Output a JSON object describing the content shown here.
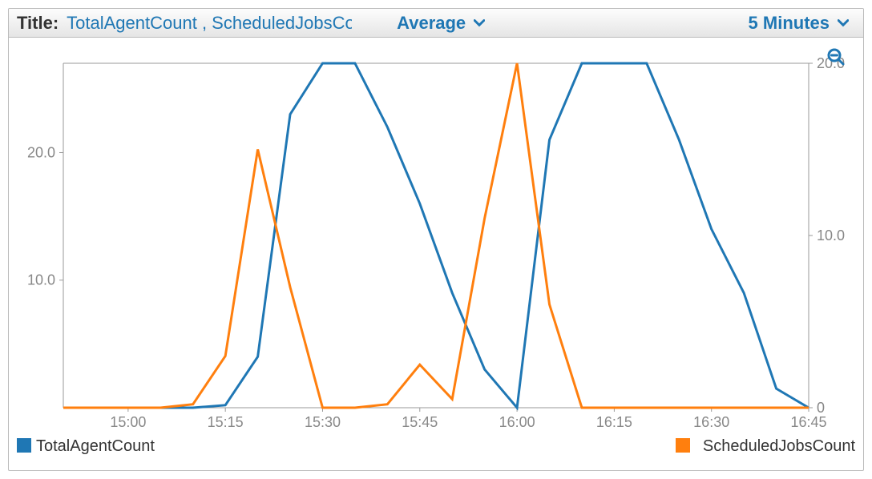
{
  "toolbar": {
    "title_label": "Title:",
    "title_value": "TotalAgentCount , ScheduledJobsCount",
    "aggregation": {
      "selected": "Average"
    },
    "period": {
      "selected": "5 Minutes"
    }
  },
  "colors": {
    "series1": "#1f77b4",
    "series2": "#ff7f0e",
    "axis_text": "#888888",
    "brand": "#1f77b4"
  },
  "chart_data": {
    "type": "line",
    "x_ticks": [
      "15:00",
      "15:15",
      "15:30",
      "15:45",
      "16:00",
      "16:15",
      "16:30",
      "16:45"
    ],
    "y_left": {
      "ticks": [
        10.0,
        20.0
      ],
      "range": [
        0,
        27
      ]
    },
    "y_right": {
      "ticks": [
        0,
        10.0,
        20.0
      ],
      "range": [
        0,
        20
      ]
    },
    "x": [
      "14:50",
      "14:55",
      "15:00",
      "15:05",
      "15:10",
      "15:15",
      "15:20",
      "15:25",
      "15:30",
      "15:35",
      "15:40",
      "15:45",
      "15:50",
      "15:55",
      "16:00",
      "16:05",
      "16:10",
      "16:15",
      "16:20",
      "16:25",
      "16:30",
      "16:35",
      "16:40",
      "16:45"
    ],
    "series": [
      {
        "name": "TotalAgentCount",
        "axis": "left",
        "values": [
          0,
          0,
          0,
          0,
          0,
          0.2,
          4,
          23,
          27,
          27,
          22,
          16,
          9,
          3,
          0,
          21,
          27,
          27,
          27,
          21,
          14,
          9,
          1.5,
          0
        ]
      },
      {
        "name": "ScheduledJobsCount",
        "axis": "right",
        "values": [
          0,
          0,
          0,
          0,
          0.2,
          3,
          15,
          7,
          0,
          0,
          0.2,
          2.5,
          0.5,
          11,
          20,
          6,
          0,
          0,
          0,
          0,
          0,
          0,
          0,
          0
        ]
      }
    ],
    "legend": [
      {
        "label": "TotalAgentCount",
        "color": "#1f77b4",
        "pos": "left"
      },
      {
        "label": "ScheduledJobsCount",
        "color": "#ff7f0e",
        "pos": "right"
      }
    ]
  }
}
